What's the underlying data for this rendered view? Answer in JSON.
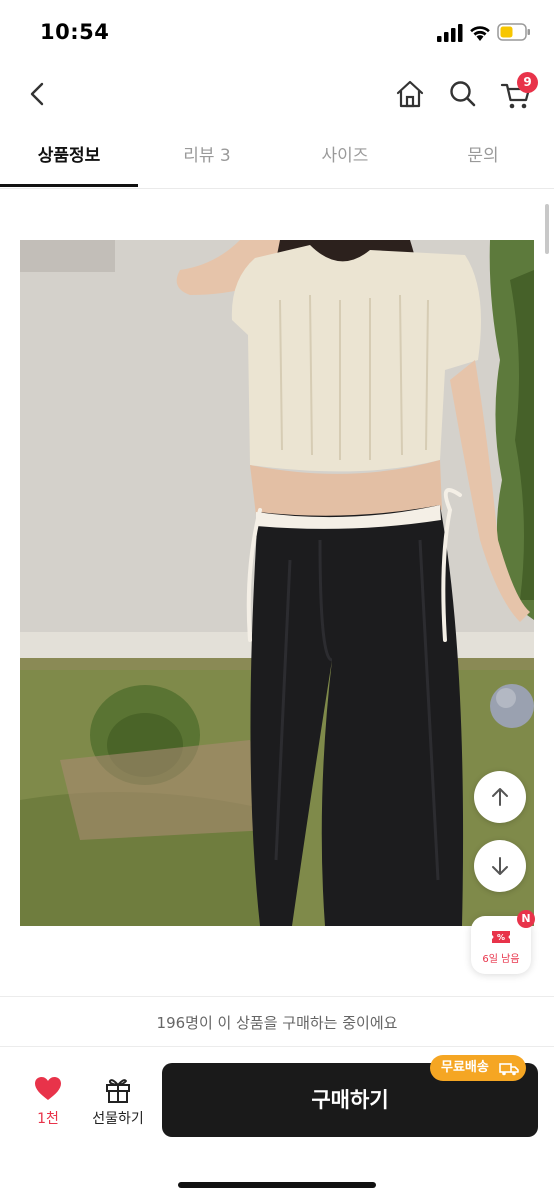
{
  "status_bar": {
    "time": "10:54",
    "battery_color": "#f7c600"
  },
  "header": {
    "back_icon": "chevron-left-icon",
    "home_icon": "home-icon",
    "search_icon": "search-icon",
    "cart_icon": "cart-icon",
    "cart_count": "9",
    "badge_color": "#e8334a"
  },
  "tabs": [
    {
      "label": "상품정보",
      "active": true
    },
    {
      "label": "리뷰 3",
      "active": false
    },
    {
      "label": "사이즈",
      "active": false
    },
    {
      "label": "문의",
      "active": false
    }
  ],
  "product_image": {
    "icon": "product-photo"
  },
  "floating": {
    "scroll_up_icon": "arrow-up-icon",
    "scroll_down_icon": "arrow-down-icon",
    "coupon_label": "6일 남음",
    "coupon_badge": "N"
  },
  "bottom_bar": {
    "purchase_notice": "196명이 이 상품을 구매하는 중이에요",
    "like_count": "1천",
    "gift_label": "선물하기",
    "buy_label": "구매하기",
    "free_shipping_label": "무료배송",
    "accent_color": "#e8334a",
    "shipping_color": "#f5a623"
  }
}
